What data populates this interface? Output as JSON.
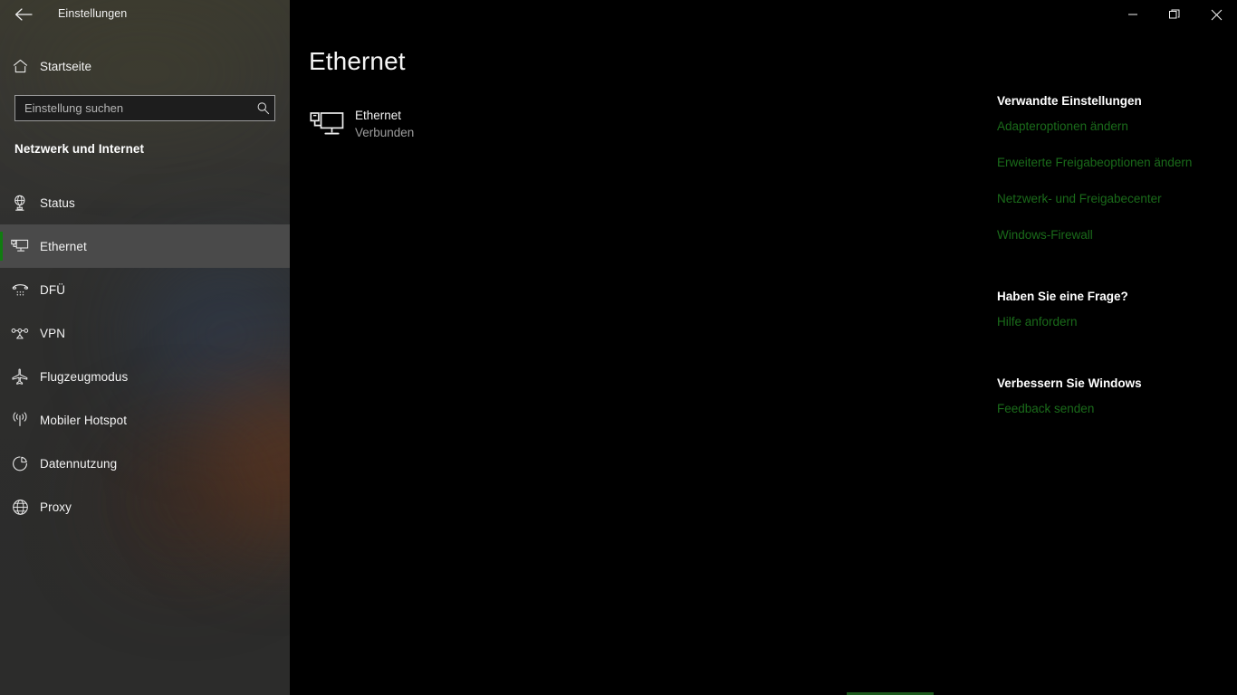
{
  "window": {
    "title": "Einstellungen",
    "back_icon": "back-arrow-icon",
    "controls": {
      "minimize": "minimize-icon",
      "restore": "restore-icon",
      "close": "close-icon"
    }
  },
  "sidebar": {
    "home": {
      "label": "Startseite",
      "icon": "home-icon"
    },
    "search": {
      "value": "",
      "placeholder": "Einstellung suchen",
      "icon": "search-icon"
    },
    "category_title": "Netzwerk und Internet",
    "items": [
      {
        "label": "Status",
        "icon": "network-status-icon",
        "selected": false
      },
      {
        "label": "Ethernet",
        "icon": "ethernet-icon",
        "selected": true
      },
      {
        "label": "DFÜ",
        "icon": "dialup-phone-icon",
        "selected": false
      },
      {
        "label": "VPN",
        "icon": "vpn-key-icon",
        "selected": false
      },
      {
        "label": "Flugzeugmodus",
        "icon": "airplane-icon",
        "selected": false
      },
      {
        "label": "Mobiler Hotspot",
        "icon": "hotspot-icon",
        "selected": false
      },
      {
        "label": "Datennutzung",
        "icon": "pie-chart-icon",
        "selected": false
      },
      {
        "label": "Proxy",
        "icon": "globe-icon",
        "selected": false
      }
    ]
  },
  "main": {
    "page_title": "Ethernet",
    "adapter": {
      "name": "Ethernet",
      "status": "Verbunden",
      "icon": "ethernet-monitor-icon"
    }
  },
  "right_panel": {
    "sections": [
      {
        "heading": "Verwandte Einstellungen",
        "links": [
          "Adapteroptionen ändern",
          "Erweiterte Freigabeoptionen ändern",
          "Netzwerk- und Freigabecenter",
          "Windows-Firewall"
        ]
      },
      {
        "heading": "Haben Sie eine Frage?",
        "links": [
          "Hilfe anfordern"
        ]
      },
      {
        "heading": "Verbessern Sie Windows",
        "links": [
          "Feedback senden"
        ]
      }
    ]
  },
  "colors": {
    "accent_green": "#107c10",
    "link_green": "#1a6b1a",
    "selected_row": "#4a4a4a",
    "sidebar_base": "#2c2c2b",
    "main_background": "#000000",
    "text_primary": "#f2f2f2",
    "text_secondary": "#9d9d9d"
  }
}
